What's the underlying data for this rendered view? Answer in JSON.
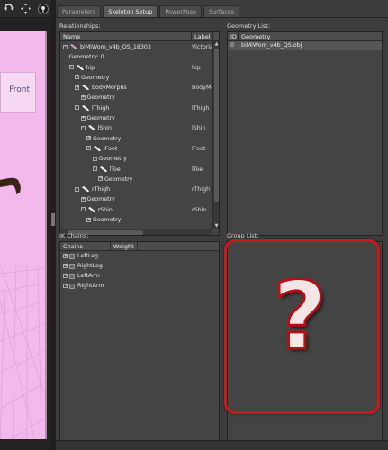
{
  "toolbar": {
    "icons": [
      "undo-icon",
      "move-icon",
      "pin-icon"
    ]
  },
  "viewport": {
    "camera_label": "Front",
    "background_color": "#f3b9ec"
  },
  "tabs": [
    {
      "label": "Parameters",
      "active": false
    },
    {
      "label": "Skeleton Setup",
      "active": true
    },
    {
      "label": "PowerPose",
      "active": false
    },
    {
      "label": "Surfaces",
      "active": false
    }
  ],
  "relationships": {
    "title": "Relationships:",
    "col_name": "Name",
    "col_label": "Label",
    "rows": [
      {
        "name": "biMiWom_v4b_QS_18303",
        "label": "Victoria",
        "indent": 0,
        "kind": "figure",
        "expander": "-"
      },
      {
        "name": "Geometry: 0",
        "label": "",
        "indent": 1,
        "kind": "text",
        "expander": ""
      },
      {
        "name": "hip",
        "label": "hip",
        "indent": 1,
        "kind": "bone",
        "expander": "-"
      },
      {
        "name": "Geometry",
        "label": "",
        "indent": 2,
        "kind": "text",
        "expander": "+"
      },
      {
        "name": "bodyMorphs",
        "label": "BodyMo",
        "indent": 2,
        "kind": "bone",
        "expander": "+"
      },
      {
        "name": "Geometry",
        "label": "",
        "indent": 3,
        "kind": "text",
        "expander": "+"
      },
      {
        "name": "lThigh",
        "label": "lThigh",
        "indent": 2,
        "kind": "bone",
        "expander": "-"
      },
      {
        "name": "Geometry",
        "label": "",
        "indent": 3,
        "kind": "text",
        "expander": "+"
      },
      {
        "name": "lShin",
        "label": "lShin",
        "indent": 3,
        "kind": "bone",
        "expander": "-"
      },
      {
        "name": "Geometry",
        "label": "",
        "indent": 4,
        "kind": "text",
        "expander": "+"
      },
      {
        "name": "lFoot",
        "label": "lFoot",
        "indent": 4,
        "kind": "bone",
        "expander": "-"
      },
      {
        "name": "Geometry",
        "label": "",
        "indent": 5,
        "kind": "text",
        "expander": "+"
      },
      {
        "name": "lToe",
        "label": "lToe",
        "indent": 5,
        "kind": "bone",
        "expander": "-"
      },
      {
        "name": "Geometry",
        "label": "",
        "indent": 6,
        "kind": "text",
        "expander": "+"
      },
      {
        "name": "rThigh",
        "label": "rThigh",
        "indent": 2,
        "kind": "bone",
        "expander": "-"
      },
      {
        "name": "Geometry",
        "label": "",
        "indent": 3,
        "kind": "text",
        "expander": "+"
      },
      {
        "name": "rShin",
        "label": "rShin",
        "indent": 3,
        "kind": "bone",
        "expander": "-"
      },
      {
        "name": "Geometry",
        "label": "",
        "indent": 4,
        "kind": "text",
        "expander": "+"
      }
    ]
  },
  "geometry_list": {
    "title": "Geometry List:",
    "col_id": "ID",
    "col_geometry": "Geometry",
    "rows": [
      {
        "id": "0",
        "geometry": "biMiWom_v4b_QS.obj"
      }
    ]
  },
  "ik_chains": {
    "title": "IK Chains:",
    "col_chains": "Chains",
    "col_weight": "Weight",
    "rows": [
      "LeftLeg",
      "RightLeg",
      "LeftArm",
      "RightArm"
    ]
  },
  "group_list": {
    "title": "Group List:",
    "overlay_glyph": "?",
    "highlight_color": "#c8181e"
  }
}
